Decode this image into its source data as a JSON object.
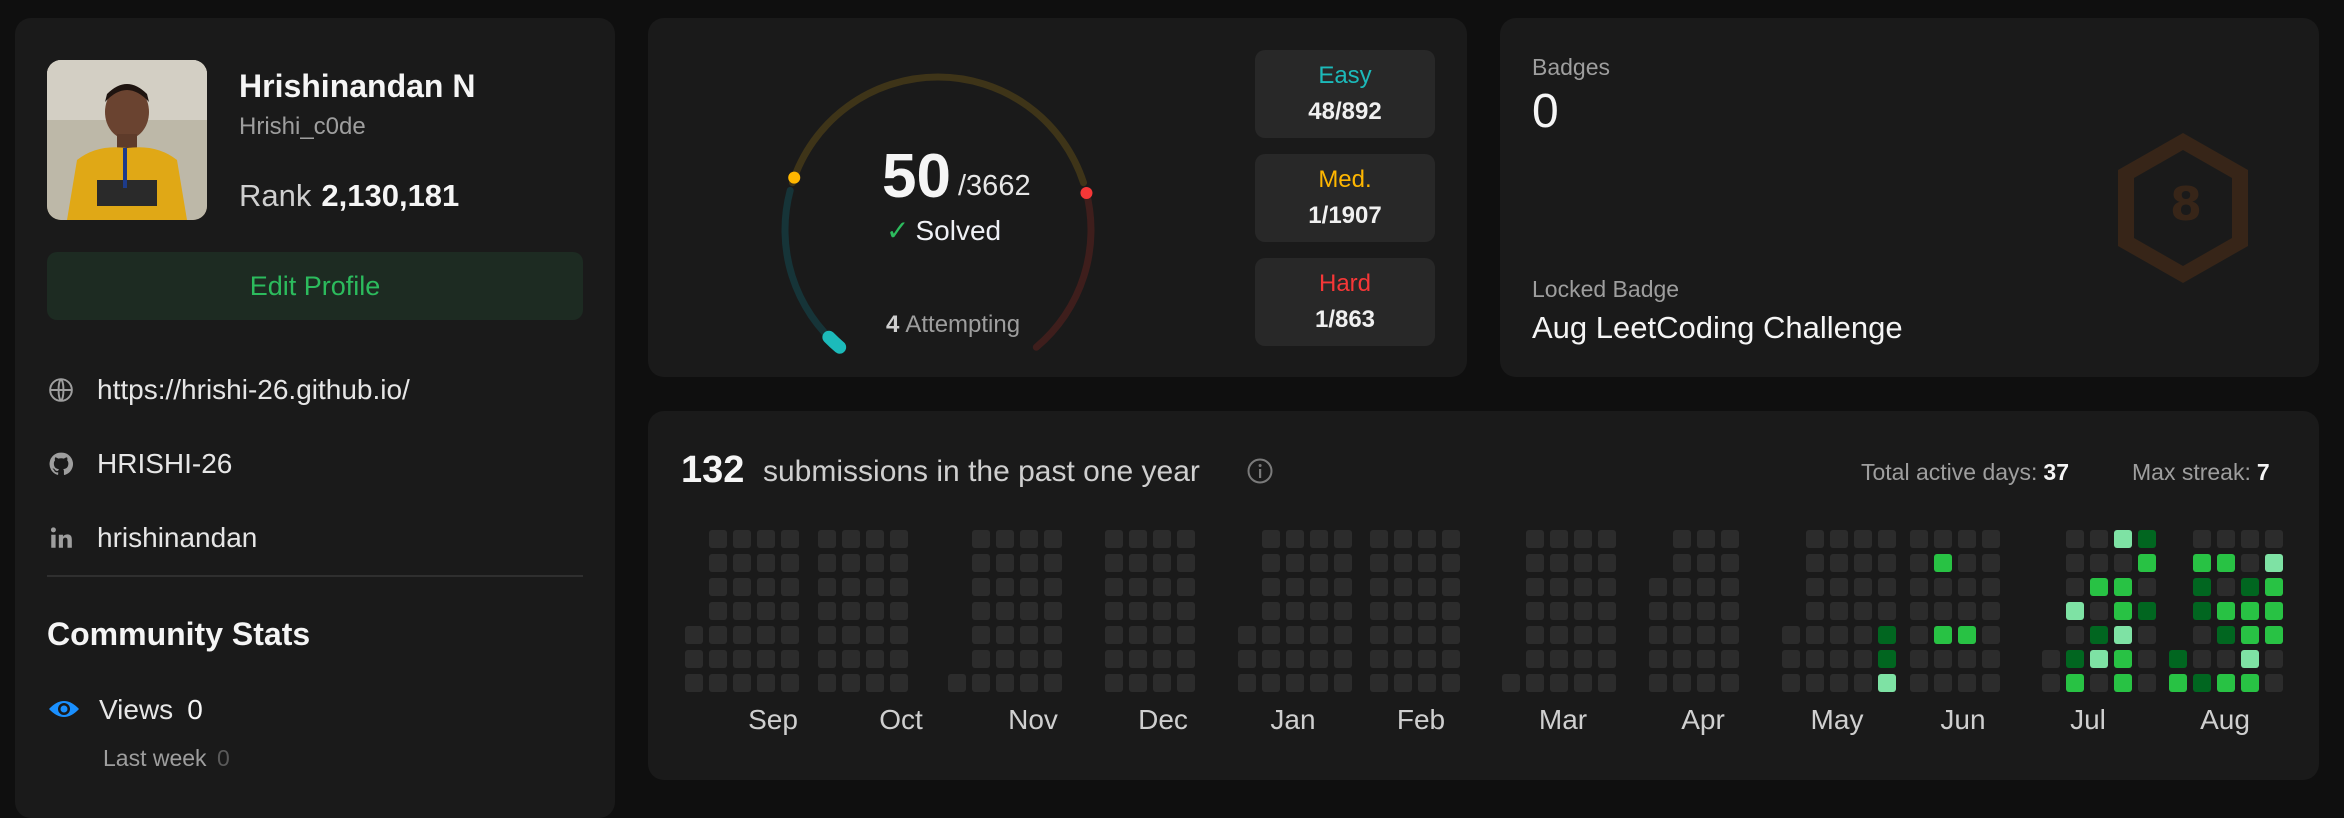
{
  "profile": {
    "name": "Hrishinandan N",
    "username": "Hrishi_c0de",
    "rank_label": "Rank",
    "rank_value": "2,130,181",
    "edit_label": "Edit Profile",
    "links": [
      {
        "icon": "globe-icon",
        "text": "https://hrishi-26.github.io/"
      },
      {
        "icon": "github-icon",
        "text": "HRISHI-26"
      },
      {
        "icon": "linkedin-icon",
        "text": "hrishinandan"
      }
    ],
    "community_title": "Community Stats",
    "views_label": "Views",
    "views_value": "0",
    "last_week_label": "Last week",
    "last_week_value": "0",
    "accent_color": "#2cbb5d"
  },
  "solved": {
    "count": "50",
    "total": "/3662",
    "label": "Solved",
    "attempting_count": "4",
    "attempting_label": "Attempting",
    "difficulties": [
      {
        "label": "Easy",
        "value": "48/892",
        "solved": 48,
        "total": 892,
        "color": "#1cbaba"
      },
      {
        "label": "Med.",
        "value": "1/1907",
        "solved": 1,
        "total": 1907,
        "color": "#ffb700"
      },
      {
        "label": "Hard",
        "value": "1/863",
        "solved": 1,
        "total": 863,
        "color": "#f63737"
      }
    ]
  },
  "badges": {
    "label": "Badges",
    "count": "0",
    "locked_label": "Locked Badge",
    "locked_name": "Aug LeetCoding Challenge",
    "badge_icon": "aug-badge-icon"
  },
  "calendar": {
    "count": "132",
    "text": "submissions in the past one year",
    "active_days_label": "Total active days:",
    "active_days_value": "37",
    "max_streak_label": "Max streak:",
    "max_streak_value": "7",
    "months": [
      "Sep",
      "Oct",
      "Nov",
      "Dec",
      "Jan",
      "Feb",
      "Mar",
      "Apr",
      "May",
      "Jun",
      "Jul",
      "Aug"
    ],
    "colors": {
      "empty": "#2c2c2c",
      "l1": "#016620",
      "l2": "#28c244",
      "l3": "#7ee2a4"
    }
  }
}
